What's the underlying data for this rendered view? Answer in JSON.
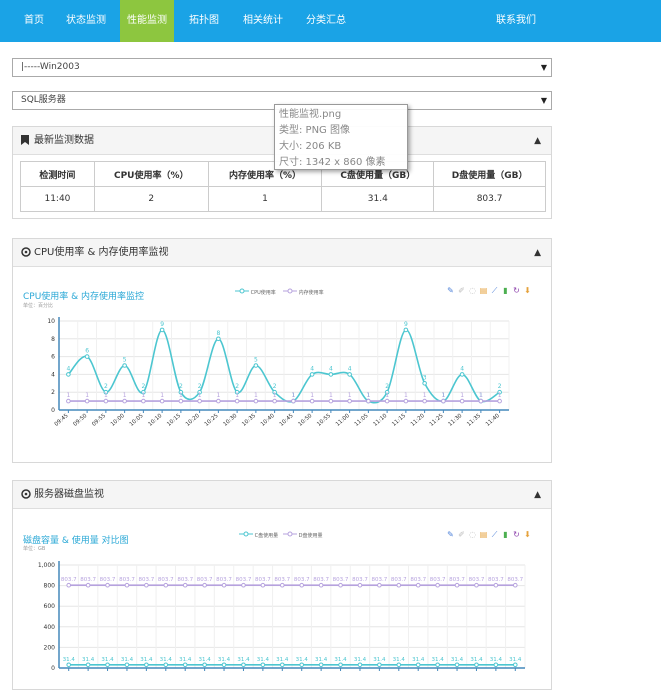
{
  "nav": {
    "items": [
      {
        "label": "首页"
      },
      {
        "label": "状态监测"
      },
      {
        "label": "性能监测"
      },
      {
        "label": "拓扑图"
      },
      {
        "label": "相关统计"
      },
      {
        "label": "分类汇总"
      }
    ],
    "contact": "联系我们"
  },
  "selects": {
    "server": "|-----Win2003",
    "service": "SQL服务器"
  },
  "latest": {
    "title": "最新监测数据",
    "headers": [
      "检测时间",
      "CPU使用率（%）",
      "内存使用率（%）",
      "C盘使用量（GB）",
      "D盘使用量（GB）"
    ],
    "row": [
      "11:40",
      "2",
      "1",
      "31.4",
      "803.7"
    ]
  },
  "cpu_panel": {
    "title": "CPU使用率 & 内存使用率监视",
    "chart_title": "CPU使用率 & 内存使用率监控",
    "unit": "单位：百分比"
  },
  "disk_panel": {
    "title": "服务器磁盘监视",
    "chart_title": "磁盘容量 & 使用量 对比图",
    "unit": "单位：GB"
  },
  "tooltip": {
    "filename": "性能监视.png",
    "type": "类型: PNG 图像",
    "size": "大小: 206 KB",
    "dims": "尺寸: 1342 x 860 像素"
  },
  "chart_data": [
    {
      "type": "line",
      "title": "CPU使用率 & 内存使用率监控",
      "x": [
        "09:45",
        "09:50",
        "09:55",
        "10:00",
        "10:05",
        "10:10",
        "10:15",
        "10:20",
        "10:25",
        "10:30",
        "10:35",
        "10:40",
        "10:45",
        "10:50",
        "10:55",
        "11:00",
        "11:05",
        "11:10",
        "11:15",
        "11:20",
        "11:25",
        "11:30",
        "11:35",
        "11:40"
      ],
      "series": [
        {
          "name": "CPU使用率",
          "color": "#4cc6d0",
          "values": [
            4,
            6,
            2,
            5,
            2,
            9,
            2,
            2,
            8,
            2,
            5,
            2,
            1,
            4,
            4,
            4,
            1,
            2,
            9,
            3,
            1,
            4,
            1,
            2
          ]
        },
        {
          "name": "内存使用率",
          "color": "#b6a2de",
          "values": [
            1,
            1,
            1,
            1,
            1,
            1,
            1,
            1,
            1,
            1,
            1,
            1,
            1,
            1,
            1,
            1,
            1,
            1,
            1,
            1,
            1,
            1,
            1,
            1
          ]
        }
      ],
      "ylim": [
        0,
        10
      ],
      "yticks": [
        0,
        2,
        4,
        6,
        8,
        10
      ],
      "legend": "top-center",
      "grid": true
    },
    {
      "type": "line",
      "title": "磁盘容量 & 使用量 对比图",
      "series": [
        {
          "name": "C盘使用量",
          "color": "#4cc6d0",
          "values": [
            31.4,
            31.4,
            31.4,
            31.4,
            31.4,
            31.4,
            31.4,
            31.4,
            31.4,
            31.4,
            31.4,
            31.4,
            31.4,
            31.4,
            31.4,
            31.4,
            31.4,
            31.4,
            31.4,
            31.4,
            31.4,
            31.4,
            31.4,
            31.4
          ]
        },
        {
          "name": "D盘使用量",
          "color": "#b6a2de",
          "values": [
            803.7,
            803.7,
            803.7,
            803.7,
            803.7,
            803.7,
            803.7,
            803.7,
            803.7,
            803.7,
            803.7,
            803.7,
            803.7,
            803.7,
            803.7,
            803.7,
            803.7,
            803.7,
            803.7,
            803.7,
            803.7,
            803.7,
            803.7,
            803.7
          ]
        }
      ],
      "ylim": [
        0,
        1000
      ],
      "yticks": [
        "0",
        "200",
        "400",
        "600",
        "800",
        "1,000"
      ],
      "legend": "top-center",
      "grid": true
    }
  ]
}
